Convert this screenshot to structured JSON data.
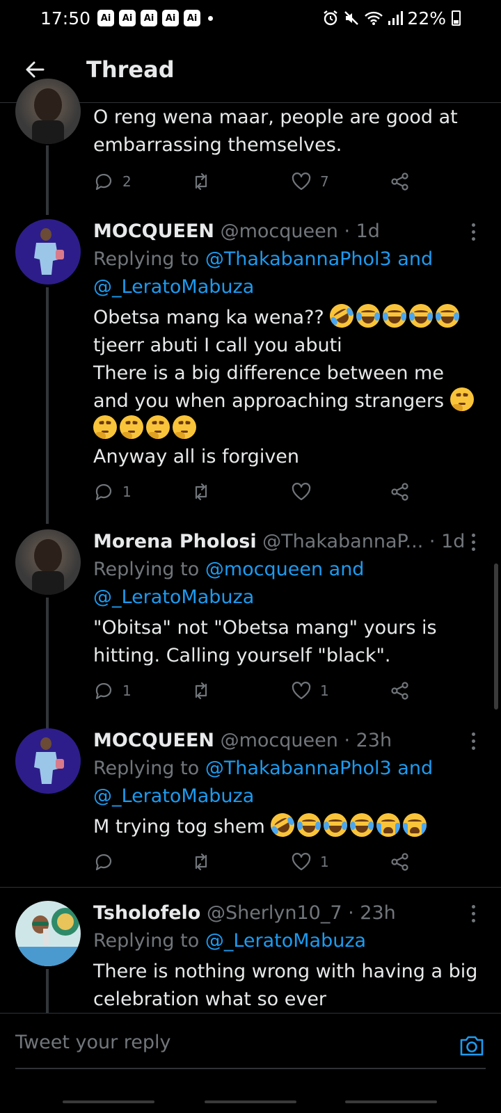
{
  "status_bar": {
    "time": "17:50",
    "ai_badges": [
      "Ai",
      "Ai",
      "Ai",
      "Ai",
      "Ai"
    ],
    "battery": "22%",
    "icons": [
      "alarm-icon",
      "mute-icon",
      "wifi-icon",
      "signal-icon",
      "battery-icon"
    ]
  },
  "header": {
    "title": "Thread",
    "back_icon": "arrow-left-icon"
  },
  "tweets": [
    {
      "text_lines": [
        "O reng wena maar, people are good at",
        "embarrassing themselves."
      ],
      "replies": "2",
      "retweets": "",
      "likes": "7"
    },
    {
      "name": "MOCQUEEN",
      "handle": "@mocqueen",
      "time": "· 1d",
      "replying_prefix": "Replying to ",
      "mentions_line1": "@ThakabannaPhol3 and",
      "mentions_line2": "@_LeratoMabuza",
      "text_lines": [
        "Obetsa mang ka wena??",
        "tjeerr abuti I call you abuti",
        "There is a big difference between me",
        "and you when approaching strangers",
        "",
        "Anyway all is forgiven"
      ],
      "replies": "1",
      "retweets": "",
      "likes": ""
    },
    {
      "name": "Morena Pholosi",
      "handle": "@ThakabannaP...",
      "time": "· 1d",
      "replying_prefix": "Replying to ",
      "mentions_line1": "@mocqueen and",
      "mentions_line2": "@_LeratoMabuza",
      "text_lines": [
        "\"Obitsa\" not \"Obetsa mang\" yours is",
        "hitting. Calling yourself \"black\"."
      ],
      "replies": "1",
      "retweets": "",
      "likes": "1"
    },
    {
      "name": "MOCQUEEN",
      "handle": "@mocqueen",
      "time": "· 23h",
      "replying_prefix": "Replying to ",
      "mentions_line1": "@ThakabannaPhol3 and",
      "mentions_line2": "@_LeratoMabuza",
      "text_lines": [
        "M trying tog shem"
      ],
      "replies": "",
      "retweets": "",
      "likes": "1"
    },
    {
      "name": "Tsholofelo",
      "handle": "@Sherlyn10_7",
      "time": "· 23h",
      "replying_prefix": "Replying to ",
      "mentions_line1": "@_LeratoMabuza",
      "text_lines": [
        "There is nothing wrong with having a big",
        "celebration what so ever"
      ]
    }
  ],
  "composer": {
    "placeholder": "Tweet your reply",
    "camera_icon": "camera-icon"
  },
  "colors": {
    "background": "#000000",
    "text": "#e7e9ea",
    "muted": "#71767b",
    "link": "#1d9bf0",
    "divider": "#2f3336"
  }
}
